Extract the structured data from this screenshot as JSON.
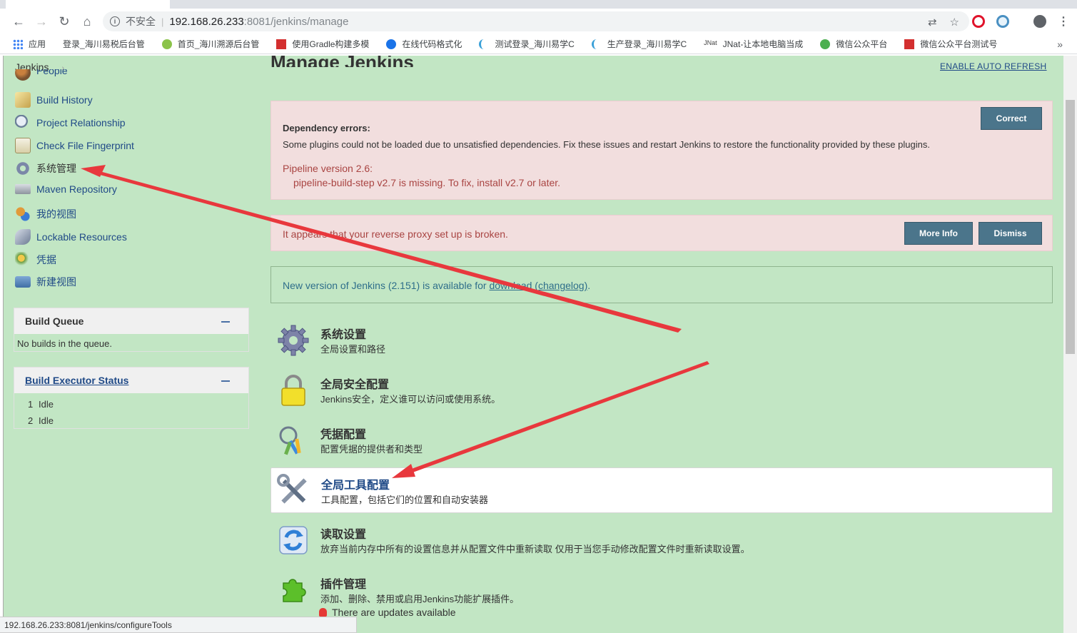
{
  "browser": {
    "security_label": "不安全",
    "url_host": "192.168.26.233",
    "url_path": ":8081/jenkins/manage",
    "bookmarks": [
      "应用",
      "登录_海川易税后台管",
      "首页_海川溯源后台管",
      "使用Gradle构建多模",
      "在线代码格式化",
      "测试登录_海川易学C",
      "生产登录_海川易学C",
      "JNat-让本地电脑当成",
      "微信公众平台",
      "微信公众平台测试号"
    ],
    "status_url": "192.168.26.233:8081/jenkins/configureTools"
  },
  "header": {
    "breadcrumb": "Jenkins",
    "auto_refresh": "ENABLE AUTO REFRESH",
    "page_title": "Manage Jenkins"
  },
  "sidebar": {
    "items": [
      {
        "label": "People"
      },
      {
        "label": "Build History"
      },
      {
        "label": "Project Relationship"
      },
      {
        "label": "Check File Fingerprint"
      },
      {
        "label": "系统管理"
      },
      {
        "label": "Maven Repository"
      },
      {
        "label": "我的视图"
      },
      {
        "label": "Lockable Resources"
      },
      {
        "label": "凭据"
      },
      {
        "label": "新建视图"
      }
    ],
    "build_queue": {
      "title": "Build Queue",
      "empty": "No builds in the queue."
    },
    "executors": {
      "title": "Build Executor Status",
      "rows": [
        {
          "num": "1",
          "state": "Idle"
        },
        {
          "num": "2",
          "state": "Idle"
        }
      ]
    }
  },
  "alerts": {
    "dependency": {
      "title": "Dependency errors:",
      "text": "Some plugins could not be loaded due to unsatisfied dependencies. Fix these issues and restart Jenkins to restore the functionality provided by these plugins.",
      "plugin": "Pipeline version 2.6:",
      "detail": "pipeline-build-step v2.7 is missing. To fix, install v2.7 or later.",
      "button": "Correct"
    },
    "proxy": {
      "text": "It appears that your reverse proxy set up is broken.",
      "more_info": "More Info",
      "dismiss": "Dismiss"
    },
    "update": {
      "prefix": "New version of Jenkins (2.151) is available for ",
      "download": "download",
      "changelog": "(changelog)",
      "suffix": "."
    }
  },
  "management": [
    {
      "title": "系统设置",
      "desc": "全局设置和路径"
    },
    {
      "title": "全局安全配置",
      "desc": "Jenkins安全，定义谁可以访问或使用系统。"
    },
    {
      "title": "凭据配置",
      "desc": "配置凭据的提供者和类型"
    },
    {
      "title": "全局工具配置",
      "desc": "工具配置，包括它们的位置和自动安装器"
    },
    {
      "title": "读取设置",
      "desc": "放弃当前内存中所有的设置信息并从配置文件中重新读取 仅用于当您手动修改配置文件时重新读取设置。"
    },
    {
      "title": "插件管理",
      "desc": "添加、删除、禁用或启用Jenkins功能扩展插件。"
    }
  ],
  "plugin_updates": "There are updates available",
  "colors": {
    "page_bg": "#c2e6c4",
    "link": "#204a87",
    "error_bg": "#f2dede",
    "error_text": "#a94442",
    "button": "#4b758b",
    "annotation_arrow": "#e8383d"
  }
}
